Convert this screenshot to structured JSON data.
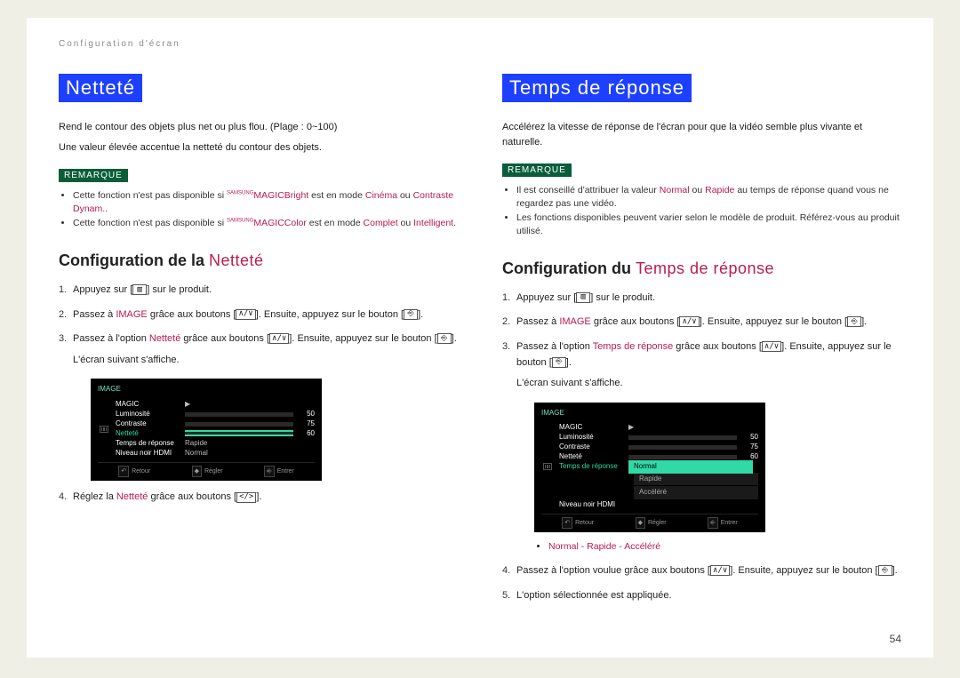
{
  "breadcrumb": "Configuration d'écran",
  "page_number": "54",
  "left": {
    "title": "Netteté",
    "intro1": "Rend le contour des objets plus net ou plus flou. (Plage : 0~100)",
    "intro2": "Une valeur élevée accentue la netteté du contour des objets.",
    "remark_label": "REMARQUE",
    "notes": {
      "n1_a": "Cette fonction n'est pas disponible si ",
      "n1_brand": "MAGICBright",
      "n1_brand_sup": "SAMSUNG",
      "n1_b": " est en mode ",
      "n1_mode1": "Cinéma",
      "n1_mid": " ou ",
      "n1_mode2": "Contraste Dynam.",
      "n1_end": ".",
      "n2_a": "Cette fonction n'est pas disponible si ",
      "n2_brand": "MAGICColor",
      "n2_brand_sup": "SAMSUNG",
      "n2_b": " est en mode ",
      "n2_mode1": "Complet",
      "n2_mid": " ou ",
      "n2_mode2": "Intelligent",
      "n2_end": "."
    },
    "section_bold": "Configuration de la ",
    "section_accent": "Netteté",
    "steps": {
      "s1_a": "Appuyez sur ",
      "s1_b": " sur le produit.",
      "s2_a": "Passez à ",
      "s2_image": "IMAGE",
      "s2_b": " grâce aux boutons ",
      "s2_c": ". Ensuite, appuyez sur le bouton ",
      "s2_d": ".",
      "s3_a": "Passez à l'option ",
      "s3_opt": "Netteté",
      "s3_b": " grâce aux boutons ",
      "s3_c": ". Ensuite, appuyez sur le bouton ",
      "s3_d": ".",
      "s3_after": "L'écran suivant s'affiche.",
      "s4_a": "Réglez la ",
      "s4_opt": "Netteté",
      "s4_b": " grâce aux boutons ",
      "s4_c": "."
    },
    "osd": {
      "header": "IMAGE",
      "magic": "MAGIC",
      "lum": "Luminosité",
      "lum_val": "50",
      "con": "Contraste",
      "con_val": "75",
      "net": "Netteté",
      "net_val": "60",
      "tdr": "Temps de réponse",
      "tdr_val": "Rapide",
      "nnh": "Niveau noir HDMI",
      "nnh_val": "Normal",
      "f_back": "Retour",
      "f_adj": "Régler",
      "f_enter": "Entrer"
    }
  },
  "right": {
    "title": "Temps de réponse",
    "intro1": "Accélérez la vitesse de réponse de l'écran pour que la vidéo semble plus vivante et naturelle.",
    "remark_label": "REMARQUE",
    "notes": {
      "n1_a": "Il est conseillé d'attribuer la valeur ",
      "n1_v1": "Normal",
      "n1_mid": " ou ",
      "n1_v2": "Rapide",
      "n1_b": " au temps de réponse quand vous ne regardez pas une vidéo.",
      "n2": "Les fonctions disponibles peuvent varier selon le modèle de produit. Référez-vous au produit utilisé."
    },
    "section_bold": "Configuration du ",
    "section_accent": "Temps de réponse",
    "steps": {
      "s1_a": "Appuyez sur ",
      "s1_b": " sur le produit.",
      "s2_a": "Passez à ",
      "s2_image": "IMAGE",
      "s2_b": " grâce aux boutons ",
      "s2_c": ". Ensuite, appuyez sur le bouton ",
      "s2_d": ".",
      "s3_a": "Passez à l'option ",
      "s3_opt": "Temps de réponse",
      "s3_b": " grâce aux boutons ",
      "s3_c": ". Ensuite, appuyez sur le bouton ",
      "s3_d": ".",
      "s3_after": "L'écran suivant s'affiche.",
      "options_line": "Normal - Rapide - Accéléré",
      "s4_a": "Passez à l'option voulue grâce aux boutons ",
      "s4_b": ". Ensuite, appuyez sur le bouton ",
      "s4_c": ".",
      "s5": "L'option sélectionnée est appliquée."
    },
    "osd": {
      "header": "IMAGE",
      "magic": "MAGIC",
      "lum": "Luminosité",
      "lum_val": "50",
      "con": "Contraste",
      "con_val": "75",
      "net": "Netteté",
      "net_val": "60",
      "tdr": "Temps de réponse",
      "opt1": "Normal",
      "opt2": "Rapide",
      "opt3": "Accéléré",
      "nnh": "Niveau noir HDMI",
      "f_back": "Retour",
      "f_adj": "Régler",
      "f_enter": "Entrer"
    }
  },
  "icons": {
    "menu": "▥",
    "updown": "∧/∨",
    "enter": "⎆",
    "leftright": "</>"
  }
}
